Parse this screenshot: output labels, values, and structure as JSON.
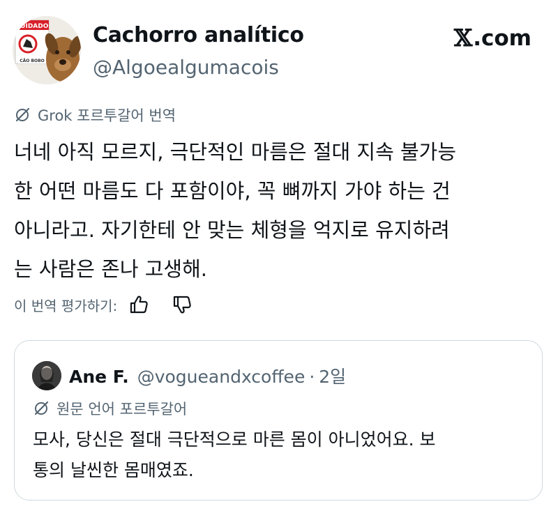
{
  "author": {
    "display_name": "Cachorro analítico",
    "handle": "@Algoealgumacois",
    "avatar_sign_text": "CUIDADO",
    "avatar_plate_text": "CÃO BOBO"
  },
  "brand": {
    "x_mark": "𝕏",
    "domain": ".com"
  },
  "translation": {
    "label": "Grok 포르투갈어 번역",
    "lines": [
      "너네 아직 모르지, 극단적인 마름은 절대 지속 불가능",
      "한 어떤 마름도 다 포함이야, 꼭 뼈까지 가야 하는 건",
      "아니라고. 자기한테 안 맞는 체형을 억지로 유지하려",
      "는 사람은 존나 고생해."
    ],
    "rate_label": "이 번역 평가하기:"
  },
  "quote": {
    "display_name": "Ane F.",
    "handle": "@vogueandxcoffee",
    "separator": "·",
    "time": "2일",
    "source_language_label": "원문 언어 포르투갈어",
    "lines": [
      "모사, 당신은 절대 극단적으로 마른 몸이 아니었어요. 보",
      "통의 날씬한 몸매였죠."
    ]
  },
  "icons": {
    "translate": "grok-slash-icon",
    "like": "thumbs-up-icon",
    "dislike": "thumbs-down-icon"
  },
  "colors": {
    "text": "#0f1419",
    "secondary": "#536471",
    "border": "#cfd9de",
    "background": "#ffffff"
  }
}
